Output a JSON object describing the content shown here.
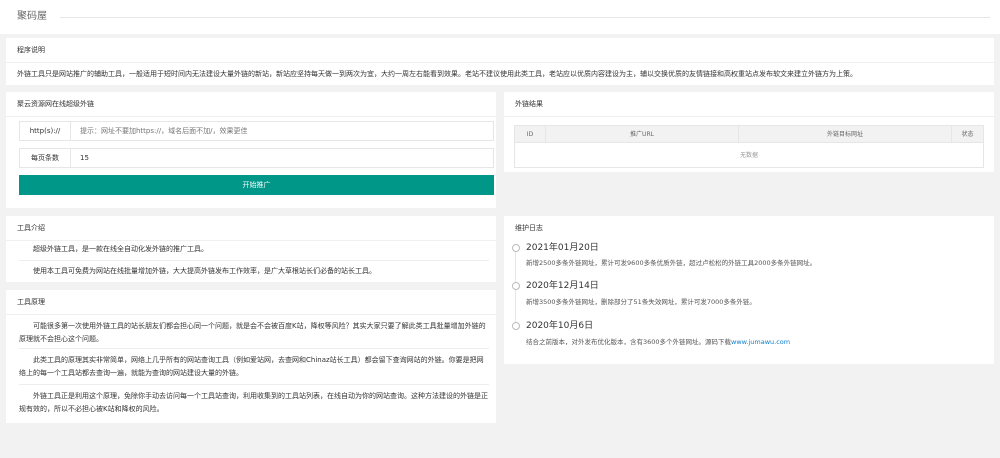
{
  "header": {
    "title": "聚码屋"
  },
  "program_desc": {
    "title": "程序说明",
    "text": "外链工具只是网站推广的辅助工具，一般适用于短时间内无法建设大量外链的新站，新站应坚持每天做一到两次为宜，大约一周左右能看到效果。老站不建议使用此类工具，老站应以优质内容建设为主，辅以交换优质的友情链接和高权重站点发布软文来建立外链方为上策。"
  },
  "form": {
    "title": "聚云资源网在线超级外链",
    "url_label": "http(s)://",
    "url_placeholder": "提示：网址不要加https://，域名后面不加/，效果更佳",
    "count_label": "每页条数",
    "count_value": "15",
    "submit_label": "开始推广"
  },
  "results": {
    "title": "外链结果",
    "columns": [
      "ID",
      "推广URL",
      "外链目标网址",
      "状态"
    ],
    "empty_text": "无数据"
  },
  "intro": {
    "title": "工具介绍",
    "paragraphs": [
      "超级外链工具，是一款在线全自动化发外链的推广工具。",
      "使用本工具可免费为网站在线批量增加外链，大大提高外链发布工作效率，是广大草根站长们必备的站长工具。"
    ]
  },
  "principle": {
    "title": "工具原理",
    "paragraphs": [
      "可能很多第一次使用外链工具的站长朋友们都会担心同一个问题，就是会不会被百度K站，降权等风险？其实大家只要了解此类工具批量增加外链的原理就不会担心这个问题。",
      "此类工具的原理其实非常简单，网络上几乎所有的网站查询工具（例如爱站网，去查网和Chinaz站长工具）都会留下查询网站的外链。你要是把网络上的每一个工具站都去查询一遍，就能为查询的网站建设大量的外链。",
      "外链工具正是利用这个原理，免除你手动去访问每一个工具站查询，利用收集到的工具站列表，在线自动为你的网站查询。这种方法建设的外链是正规有效的，所以不必担心被K站和降权的风险。"
    ]
  },
  "log": {
    "title": "维护日志",
    "events": [
      {
        "date": "2021年01月20日",
        "text": "新增2500多条外链网址，累计可发9600多条优质外链，超过卢松松的外链工具2000多条外链网址。"
      },
      {
        "date": "2020年12月14日",
        "text": "新增3500多条外链网址，删除部分了51条失效网址，累计可发7000多条外链。"
      },
      {
        "date": "2020年10月6日",
        "text": "结合之前版本，对外发布优化版本，含有3600多个外链网址。源码下载",
        "link": "www.jumawu.com"
      }
    ]
  }
}
